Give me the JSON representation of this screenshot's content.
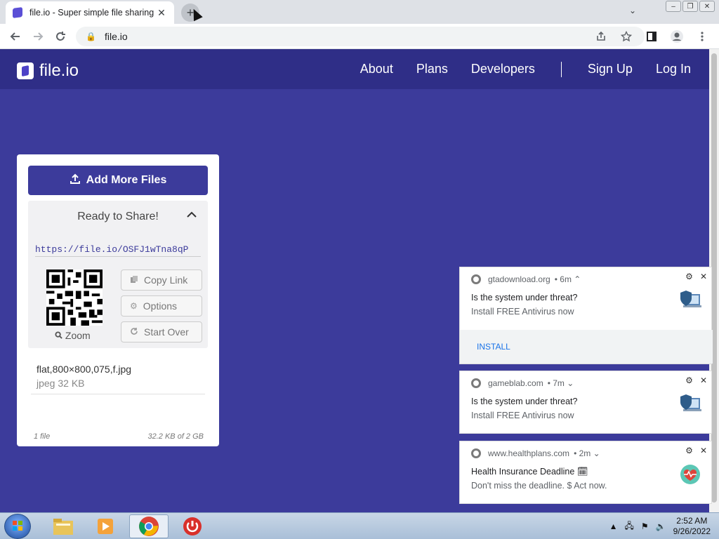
{
  "browser": {
    "tab_title": "file.io - Super simple file sharing",
    "tab_close": "✕",
    "new_tab": "+",
    "url": "file.io",
    "tab_dropdown": "⌄",
    "window_buttons": [
      "–",
      "❐",
      "✕"
    ]
  },
  "site": {
    "logo_text": "file.io",
    "nav": [
      "About",
      "Plans",
      "Developers",
      "Sign Up",
      "Log In"
    ]
  },
  "card": {
    "add_button": "Add More Files",
    "ready_label": "Ready to Share!",
    "share_link": "https://file.io/OSFJ1wTna8qP",
    "zoom_label": "Zoom",
    "copy_link": "Copy Link",
    "options": "Options",
    "start_over": "Start Over",
    "file_name": "flat,800×800,075,f.jpg",
    "file_meta": "jpeg 32 KB",
    "footer_count": "1 file",
    "footer_size": "32.2 KB of 2 GB"
  },
  "notifications": [
    {
      "source": "gtadownload.org",
      "age": "• 6m ⌃",
      "title": "Is the system under threat?",
      "body": "Install FREE Antivirus now",
      "action": "INSTALL",
      "icon": "shield-laptop-icon"
    },
    {
      "source": "gameblab.com",
      "age": "• 7m ⌄",
      "title": "Is the system under threat?",
      "body": "Install FREE Antivirus now",
      "icon": "shield-laptop-icon"
    },
    {
      "source": "www.healthplans.com",
      "age": "• 2m ⌄",
      "title": "Health Insurance Deadline 🗓",
      "body": "Don't miss the deadline. $ Act now.",
      "icon": "heart-pulse-icon"
    }
  ],
  "taskbar": {
    "time": "2:52 AM",
    "date": "9/26/2022"
  },
  "colors": {
    "page_bg": "#3c3b9b",
    "nav_bg": "#2f2e87",
    "accent": "#3c3b9b",
    "notif_action": "#1a73e8"
  }
}
